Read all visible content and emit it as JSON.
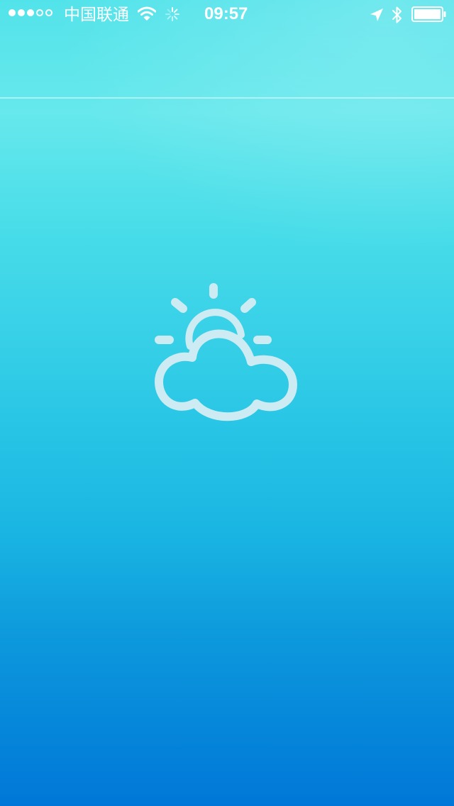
{
  "status_bar": {
    "carrier": "中国联通",
    "time": "09:57",
    "signal": {
      "filled": 3,
      "total": 5
    },
    "icons": [
      "wifi-icon",
      "activity-spinner-icon",
      "location-arrow-icon",
      "bluetooth-icon",
      "battery-icon"
    ],
    "battery_level": 1.0
  },
  "main": {
    "weather_icon": "partly-cloudy-icon"
  },
  "colors": {
    "gradient_top": "#52e3ea",
    "gradient_mid": "#2cc8e6",
    "gradient_bottom": "#0077d8",
    "icon_color": "#cdebf2",
    "status_text": "#ffffff"
  }
}
